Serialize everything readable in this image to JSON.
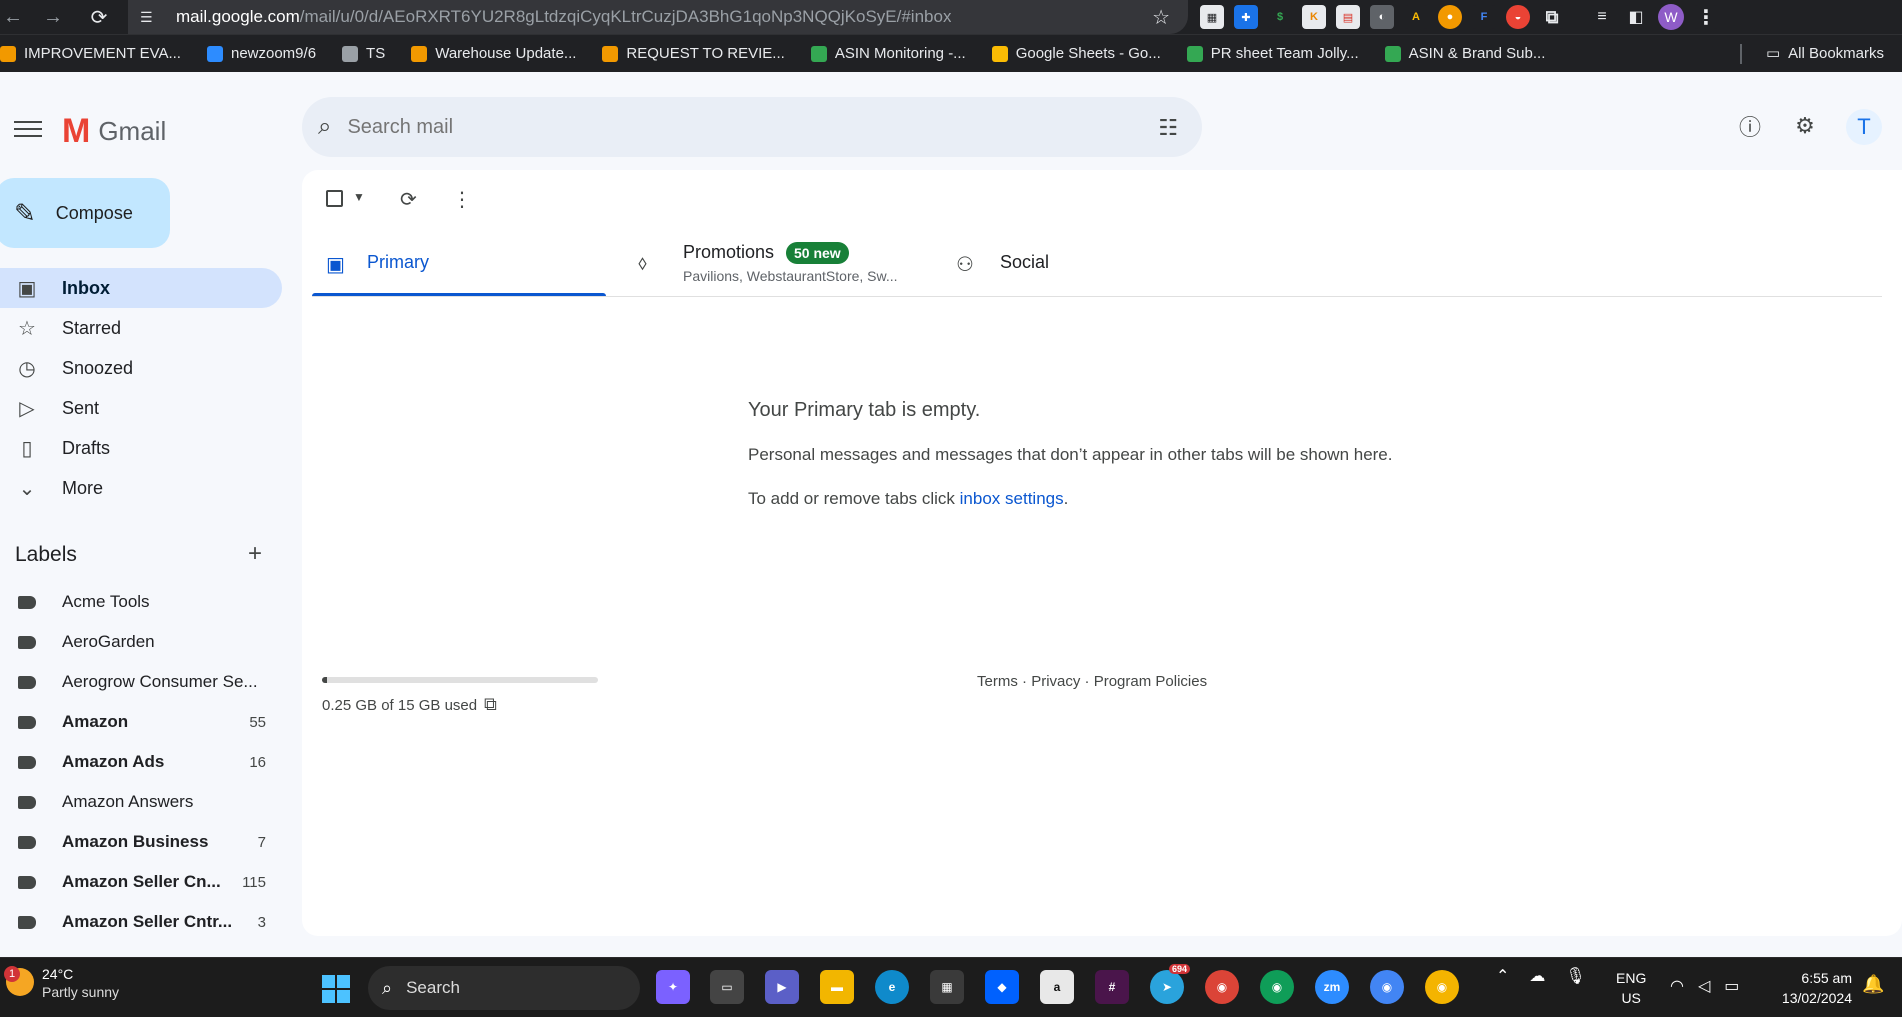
{
  "browser": {
    "url_host": "mail.google.com",
    "url_path": "/mail/u/0/d/AEoRXRT6YU2R8gLtdzqiCyqKLtrCuzjDA3BhG1qoNp3NQQjKoSyE/#inbox",
    "profile_initial": "W",
    "bookmarks": [
      {
        "label": "IMPROVEMENT EVA...",
        "color": "#f29900"
      },
      {
        "label": "newzoom9/6",
        "color": "#2d8cff"
      },
      {
        "label": "TS",
        "color": "#9aa0a6"
      },
      {
        "label": "Warehouse Update...",
        "color": "#f29900"
      },
      {
        "label": "REQUEST TO REVIE...",
        "color": "#f29900"
      },
      {
        "label": "ASIN Monitoring -...",
        "color": "#34a853"
      },
      {
        "label": "Google Sheets - Go...",
        "color": "#fbbc04"
      },
      {
        "label": "PR sheet Team Jolly...",
        "color": "#34a853"
      },
      {
        "label": "ASIN & Brand Sub...",
        "color": "#34a853"
      }
    ],
    "all_bookmarks": "All Bookmarks"
  },
  "header": {
    "brand": "Gmail",
    "search_placeholder": "Search mail",
    "account_initial": "T"
  },
  "sidebar": {
    "compose": "Compose",
    "items": [
      {
        "label": "Inbox",
        "icon": "inbox-icon",
        "glyph": "▣"
      },
      {
        "label": "Starred",
        "icon": "star-icon",
        "glyph": "☆"
      },
      {
        "label": "Snoozed",
        "icon": "clock-icon",
        "glyph": "◷"
      },
      {
        "label": "Sent",
        "icon": "send-icon",
        "glyph": "▷"
      },
      {
        "label": "Drafts",
        "icon": "draft-icon",
        "glyph": "▯"
      },
      {
        "label": "More",
        "icon": "chevron-down-icon",
        "glyph": "⌄"
      }
    ],
    "labels_title": "Labels",
    "labels": [
      {
        "name": "Acme Tools",
        "count": "",
        "bold": false
      },
      {
        "name": "AeroGarden",
        "count": "",
        "bold": false
      },
      {
        "name": "Aerogrow Consumer Se...",
        "count": "",
        "bold": false
      },
      {
        "name": "Amazon",
        "count": "55",
        "bold": true
      },
      {
        "name": "Amazon Ads",
        "count": "16",
        "bold": true
      },
      {
        "name": "Amazon Answers",
        "count": "",
        "bold": false
      },
      {
        "name": "Amazon Business",
        "count": "7",
        "bold": true
      },
      {
        "name": "Amazon Seller Cn...",
        "count": "115",
        "bold": true
      },
      {
        "name": "Amazon Seller Cntr...",
        "count": "3",
        "bold": true
      }
    ]
  },
  "tabs": {
    "primary": "Primary",
    "promotions": "Promotions",
    "promotions_badge": "50 new",
    "promotions_senders": "Pavilions, WebstaurantStore, Sw...",
    "social": "Social"
  },
  "empty_state": {
    "title": "Your Primary tab is empty.",
    "description": "Personal messages and messages that don’t appear in other tabs will be shown here.",
    "tip_prefix": "To add or remove tabs click ",
    "tip_link": "inbox settings",
    "tip_suffix": "."
  },
  "storage": {
    "text": "0.25 GB of 15 GB used",
    "used_fraction": 0.017
  },
  "footer": {
    "terms": "Terms",
    "privacy": "Privacy",
    "policies": "Program Policies",
    "sep": " · "
  },
  "taskbar": {
    "weather_temp": "24°C",
    "weather_cond": "Partly sunny",
    "weather_badge": "1",
    "search": "Search",
    "telegram_count": "694",
    "lang": "ENG",
    "region": "US",
    "time": "6:55 am",
    "date": "13/02/2024"
  }
}
